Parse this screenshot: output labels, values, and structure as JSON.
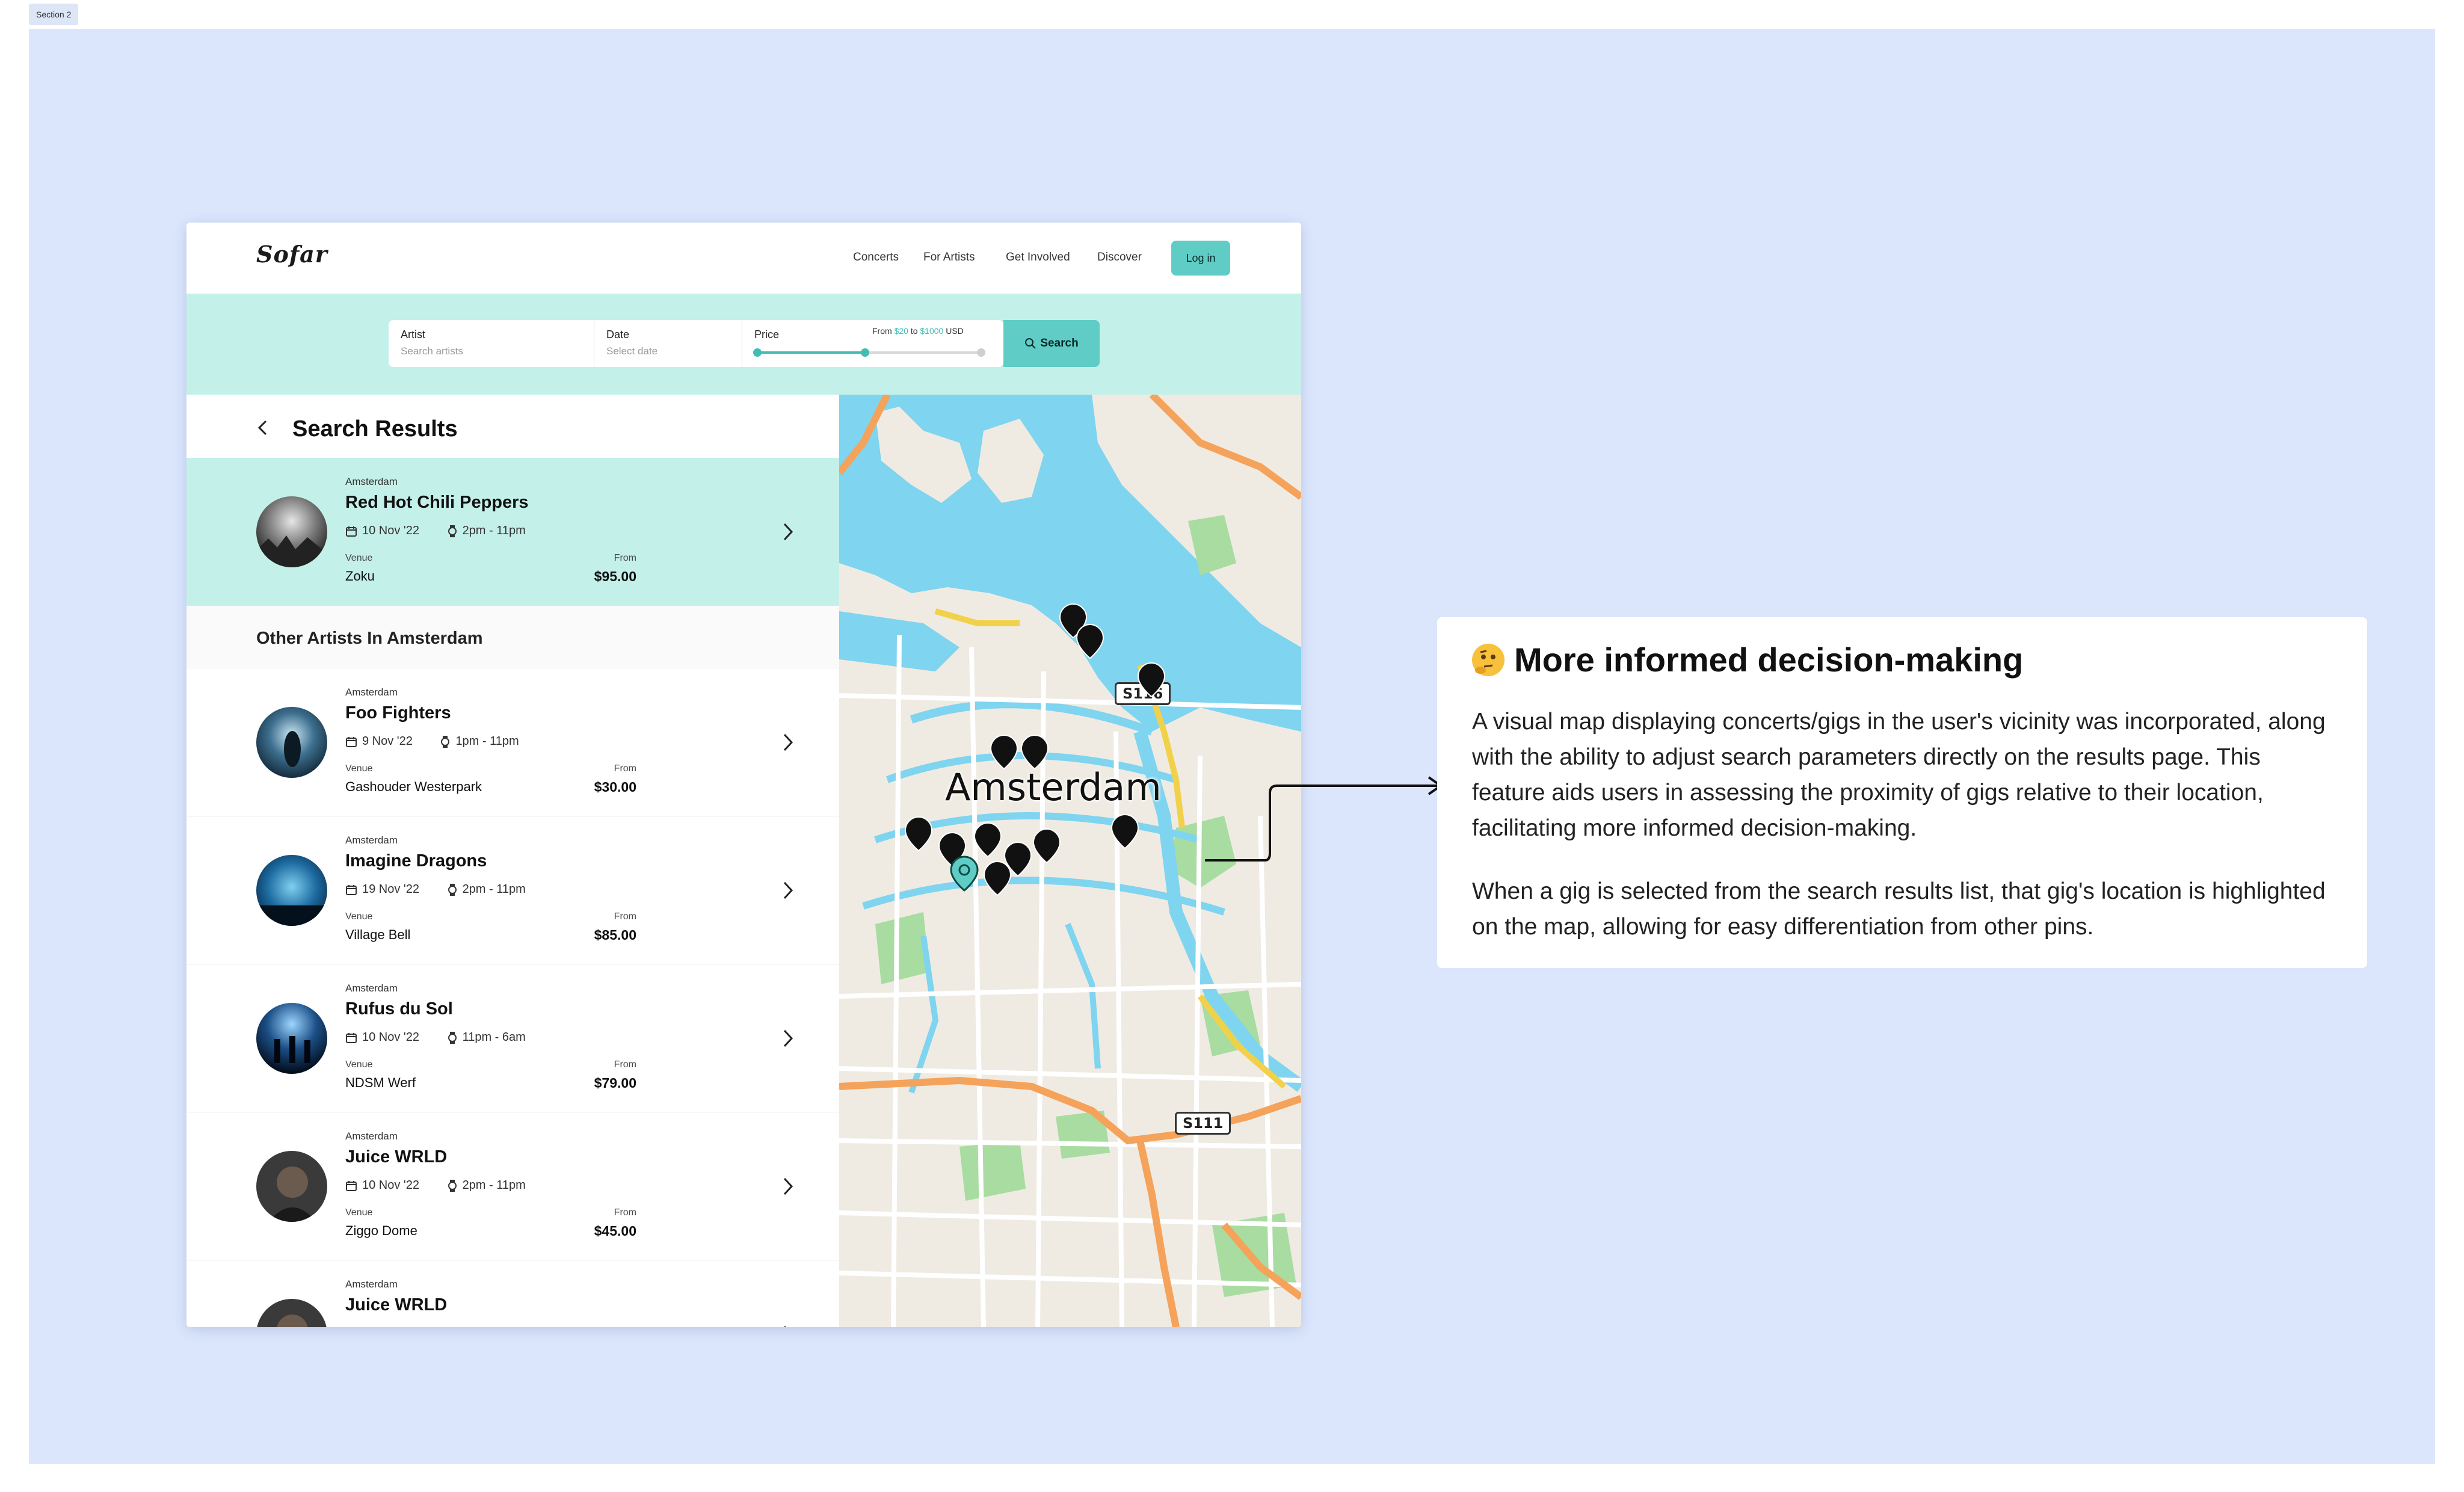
{
  "section_tag": "Section 2",
  "nav": {
    "logo": "Sofar",
    "links": [
      "Concerts",
      "For Artists",
      "Get Involved",
      "Discover"
    ],
    "login": "Log in"
  },
  "search": {
    "artist_label": "Artist",
    "artist_placeholder": "Search artists",
    "date_label": "Date",
    "date_placeholder": "Select date",
    "price_label": "Price",
    "price_from": "From",
    "price_min": "$20",
    "price_to": "to",
    "price_max": "$1000",
    "price_currency": "USD",
    "slider_low_pct": 0,
    "slider_high_pct": 48,
    "button": "Search"
  },
  "results": {
    "title": "Search Results",
    "other_title": "Other Artists In Amsterdam",
    "venue_label": "Venue",
    "from_label": "From",
    "selected": {
      "city": "Amsterdam",
      "name": "Red Hot Chili Peppers",
      "date": "10 Nov '22",
      "time": "2pm - 11pm",
      "venue": "Zoku",
      "price": "$95.00"
    },
    "others": [
      {
        "city": "Amsterdam",
        "name": "Foo Fighters",
        "date": "9 Nov '22",
        "time": "1pm  - 11pm",
        "venue": "Gashouder Westerpark",
        "price": "$30.00"
      },
      {
        "city": "Amsterdam",
        "name": "Imagine Dragons",
        "date": "19 Nov '22",
        "time": "2pm  - 11pm",
        "venue": "Village Bell",
        "price": "$85.00"
      },
      {
        "city": "Amsterdam",
        "name": "Rufus du Sol",
        "date": "10 Nov '22",
        "time": "11pm  - 6am",
        "venue": "NDSM Werf",
        "price": "$79.00"
      },
      {
        "city": "Amsterdam",
        "name": "Juice WRLD",
        "date": "10 Nov '22",
        "time": "2pm  - 11pm",
        "venue": "Ziggo Dome",
        "price": "$45.00"
      },
      {
        "city": "Amsterdam",
        "name": "Juice WRLD",
        "date": "",
        "time": "",
        "venue": "",
        "price": ""
      }
    ]
  },
  "map": {
    "city_label": "Amsterdam",
    "road_badges": [
      "S116",
      "S111"
    ]
  },
  "info": {
    "title": "More informed decision-making",
    "para1": "A visual map displaying concerts/gigs in the user's vicinity was incorporated, along with the ability to adjust search parameters directly on the results page. This feature aids users in assessing the proximity of gigs relative to their location, facilitating more informed decision-making.",
    "para2": "When a gig is selected from the search results list, that gig's location is highlighted on the map, allowing for easy differentiation from other pins."
  },
  "colors": {
    "accent": "#5fcdc5",
    "band": "#c4f0ea",
    "canvas": "#dbe6fd",
    "water": "#7fd4ef",
    "road": "#f5a25a"
  }
}
